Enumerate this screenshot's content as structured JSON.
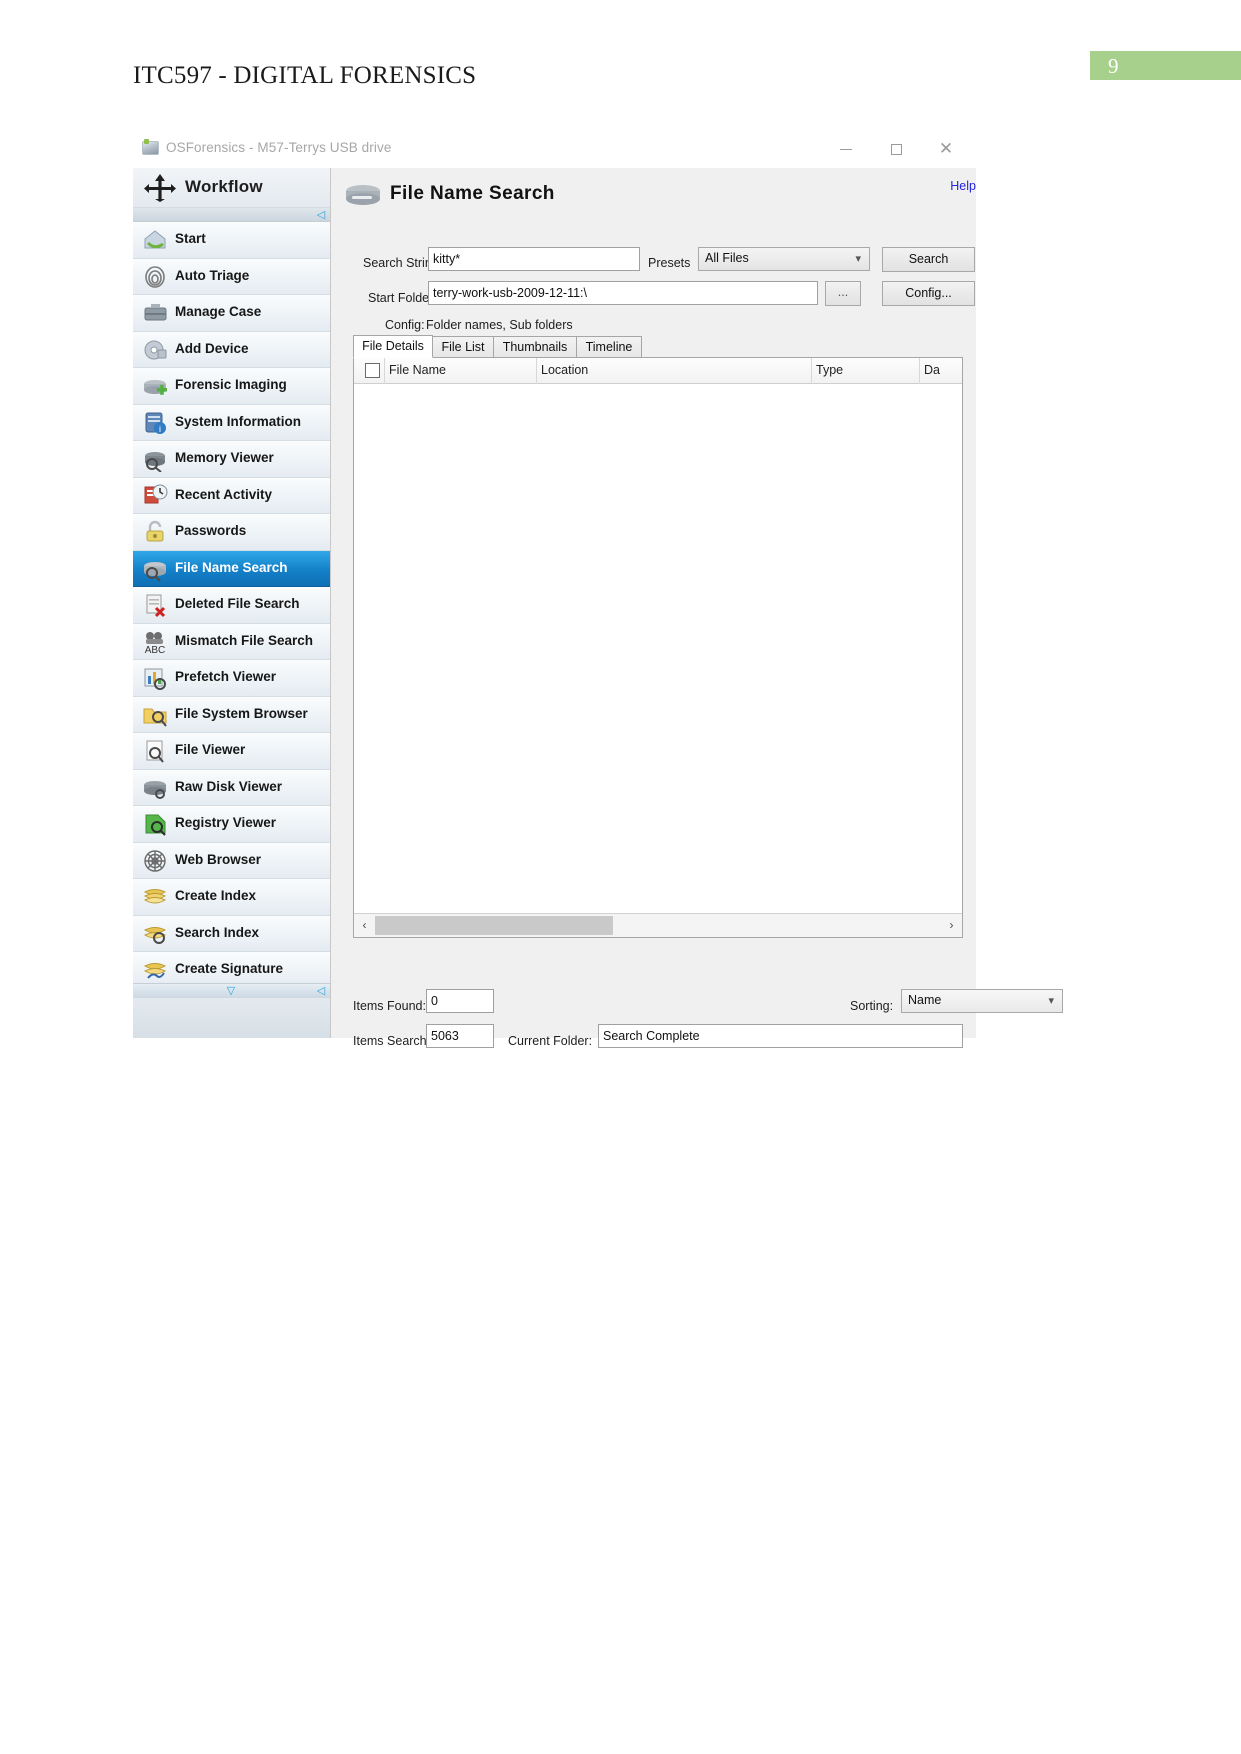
{
  "document": {
    "title": "ITC597 - DIGITAL FORENSICS",
    "page_number": "9",
    "page_badge_color": "#a8d08d"
  },
  "window": {
    "title": "OSForensics - M57-Terrys USB drive",
    "icon": "disk-icon",
    "minimize": "–",
    "maximize": "□",
    "close": "✕"
  },
  "sidebar": {
    "header": "Workflow",
    "scroll_up": "◁",
    "scroll_down": "▽",
    "scroll_down_left": "◁",
    "items": [
      {
        "label": "Start",
        "icon": "home-start-icon",
        "selected": false
      },
      {
        "label": "Auto Triage",
        "icon": "fingerprint-icon",
        "selected": false
      },
      {
        "label": "Manage Case",
        "icon": "briefcase-icon",
        "selected": false
      },
      {
        "label": "Add Device",
        "icon": "disc-drive-icon",
        "selected": false
      },
      {
        "label": "Forensic Imaging",
        "icon": "drive-plus-icon",
        "selected": false
      },
      {
        "label": "System Information",
        "icon": "system-info-icon",
        "selected": false
      },
      {
        "label": "Memory Viewer",
        "icon": "memory-magnifier-icon",
        "selected": false
      },
      {
        "label": "Recent Activity",
        "icon": "clock-history-icon",
        "selected": false
      },
      {
        "label": "Passwords",
        "icon": "padlock-icon",
        "selected": false
      },
      {
        "label": "File Name Search",
        "icon": "drive-search-icon",
        "selected": true
      },
      {
        "label": "Deleted File Search",
        "icon": "file-delete-icon",
        "selected": false
      },
      {
        "label": "Mismatch File Search",
        "icon": "abc-mismatch-icon",
        "selected": false
      },
      {
        "label": "Prefetch Viewer",
        "icon": "chart-magnifier-icon",
        "selected": false
      },
      {
        "label": "File System Browser",
        "icon": "folder-search-icon",
        "selected": false
      },
      {
        "label": "File Viewer",
        "icon": "document-magnifier-icon",
        "selected": false
      },
      {
        "label": "Raw Disk Viewer",
        "icon": "raw-disk-icon",
        "selected": false
      },
      {
        "label": "Registry Viewer",
        "icon": "registry-key-icon",
        "selected": false
      },
      {
        "label": "Web Browser",
        "icon": "web-globe-icon",
        "selected": false
      },
      {
        "label": "Create Index",
        "icon": "index-create-icon",
        "selected": false
      },
      {
        "label": "Search Index",
        "icon": "index-search-icon",
        "selected": false
      },
      {
        "label": "Create Signature",
        "icon": "signature-icon",
        "selected": false
      }
    ]
  },
  "main": {
    "panel_icon": "drive-search-icon",
    "panel_title": "File Name Search",
    "help_link": "Help",
    "search_string_label": "Search String",
    "search_string_value": "kitty*",
    "search_string_placeholder": "",
    "presets_label": "Presets",
    "presets_value": "All Files",
    "presets_options": [
      "All Files"
    ],
    "search_button": "Search",
    "config_button": "Config...",
    "start_folder_label": "Start Folder",
    "start_folder_value": "terry-work-usb-2009-12-11:\\",
    "start_folder_placeholder": "",
    "browse_button": "...",
    "config_label": "Config:",
    "config_value": "Folder names, Sub folders",
    "tabs": [
      {
        "label": "File Details",
        "active": true
      },
      {
        "label": "File List",
        "active": false
      },
      {
        "label": "Thumbnails",
        "active": false
      },
      {
        "label": "Timeline",
        "active": false
      }
    ],
    "table": {
      "columns": [
        "File Name",
        "Location",
        "Type",
        "Da"
      ],
      "rows": []
    },
    "hscroll_left": "‹",
    "hscroll_right": "›"
  },
  "status": {
    "items_found_label": "Items Found:",
    "items_found_value": "0",
    "items_searched_label": "Items Searched:",
    "items_searched_value": "5063",
    "current_folder_label": "Current Folder:",
    "current_folder_value": "Search Complete",
    "sorting_label": "Sorting:",
    "sorting_value": "Name",
    "sorting_options": [
      "Name"
    ]
  }
}
